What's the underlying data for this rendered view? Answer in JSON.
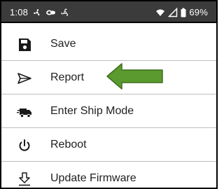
{
  "status_bar": {
    "time": "1:08",
    "notification_icons": [
      "fan-icon",
      "link-icon",
      "fan-icon"
    ],
    "battery": "69%"
  },
  "menu": {
    "items": [
      {
        "label": "Save",
        "icon": "save-icon"
      },
      {
        "label": "Report",
        "icon": "send-icon"
      },
      {
        "label": "Enter Ship Mode",
        "icon": "truck-icon"
      },
      {
        "label": "Reboot",
        "icon": "power-icon"
      },
      {
        "label": "Update Firmware",
        "icon": "download-icon"
      }
    ]
  },
  "annotation": {
    "arrow_color": "#5a9a2e",
    "arrow_outline": "#3e6f1e"
  },
  "colors": {
    "status_bar_bg": "#3b3b3b",
    "divider": "#bdbdbd",
    "text": "#212121"
  }
}
